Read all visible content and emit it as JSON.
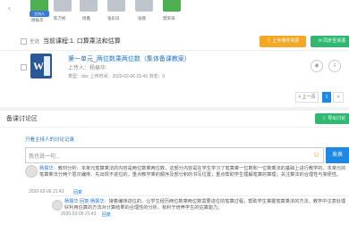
{
  "participants": [
    {
      "name": "杨振华",
      "host": "主持人"
    },
    {
      "name": "陈万彬"
    },
    {
      "name": "周鑫"
    },
    {
      "name": "张彩凤"
    },
    {
      "name": "张薇"
    },
    {
      "name": "樊荣海"
    }
  ],
  "course": {
    "select_all": "全选",
    "current_course": "当前课程:1. 口算乘法和估算",
    "upload_btn": "上传课件资源",
    "sync_btn": "同步至资源"
  },
  "file": {
    "title": "第一单元_两位数乘两位数（集体备课教案）",
    "uploader": "上传人：杨振华",
    "meta": "类型：doc   上传时间：2020-02-06 21:43   浏览：0",
    "eye_icon": "eye-icon",
    "download_icon": "download-icon"
  },
  "pagination": {
    "prev": "< 上一页",
    "current": "1",
    "next": ">"
  },
  "discussion": {
    "title": "备课讨论区",
    "export_btn": "导出讨论",
    "view_mine": "只看主持人的讨论记录",
    "input_placeholder": "我也说一句...",
    "send_btn": "发表",
    "emoji_icon": "smiley-icon"
  },
  "comments": [
    {
      "user": "杨振华：",
      "text": "教材分析：本单元笔算乘法的内容是两位数乘两位数，这部分内容是在学生学习了笔算乘一位数和一位数乘法的基础上进行教学的。本单元的笔算乘法分两个层次编排。先出现不进位的，重点教学乘的顺序及部分积的书写位置；重点帮助学生理解笔算的算理；关注算法的合理性与简便性。",
      "time": "2020-02-06 21:43",
      "reply": "回复",
      "reply_obj": {
        "user": "杨振华 回复 杨振华：",
        "text": "接着编排进位的，让学生经历两位数乘两位数需要进位的笔算过程，帮助学生掌握笔算乘法的方法。教学中注意处理好利用估算的方法对计算结果的合理性的分析，有利于培养学生的估算能力。",
        "time": "2020-02-06 21:43",
        "reply": "回复"
      }
    }
  ],
  "colors": {
    "accent": "#1e88e5",
    "orange": "#f5a623",
    "green": "#2eb872"
  }
}
